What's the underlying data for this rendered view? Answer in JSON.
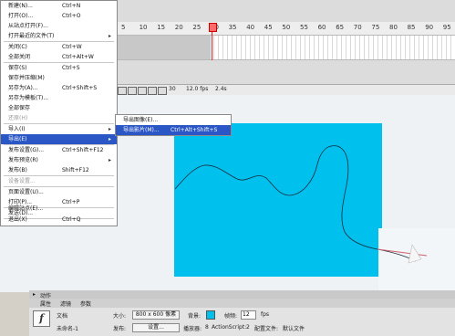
{
  "menu": {
    "items": [
      {
        "label": "新建(N)...",
        "shortcut": "Ctrl+N",
        "disabled": false,
        "submenu": false
      },
      {
        "label": "打开(O)...",
        "shortcut": "Ctrl+O",
        "disabled": false,
        "submenu": false
      },
      {
        "label": "从站点打开(F)...",
        "shortcut": "",
        "disabled": false,
        "submenu": false
      },
      {
        "label": "打开最近的文件(T)",
        "shortcut": "",
        "disabled": false,
        "submenu": true
      },
      {
        "label": "关闭(C)",
        "shortcut": "Ctrl+W",
        "disabled": false,
        "submenu": false
      },
      {
        "label": "全部关闭",
        "shortcut": "Ctrl+Alt+W",
        "disabled": false,
        "submenu": false
      },
      {
        "label": "保存(S)",
        "shortcut": "Ctrl+S",
        "disabled": false,
        "submenu": false
      },
      {
        "label": "保存并压缩(M)",
        "shortcut": "",
        "disabled": false,
        "submenu": false
      },
      {
        "label": "另存为(A)...",
        "shortcut": "Ctrl+Shift+S",
        "disabled": false,
        "submenu": false
      },
      {
        "label": "另存为模板(T)...",
        "shortcut": "",
        "disabled": false,
        "submenu": false
      },
      {
        "label": "全部保存",
        "shortcut": "",
        "disabled": false,
        "submenu": false
      },
      {
        "label": "还原(H)",
        "shortcut": "",
        "disabled": true,
        "submenu": false
      },
      {
        "label": "导入(I)",
        "shortcut": "",
        "disabled": false,
        "submenu": true
      },
      {
        "label": "导出(E)",
        "shortcut": "",
        "disabled": false,
        "submenu": true,
        "highlighted": true
      },
      {
        "label": "发布设置(G)...",
        "shortcut": "Ctrl+Shift+F12",
        "disabled": false,
        "submenu": false
      },
      {
        "label": "发布预览(R)",
        "shortcut": "",
        "disabled": false,
        "submenu": true
      },
      {
        "label": "发布(B)",
        "shortcut": "Shift+F12",
        "disabled": false,
        "submenu": false
      },
      {
        "label": "设备设置...",
        "shortcut": "",
        "disabled": true,
        "submenu": false
      },
      {
        "label": "页面设置(U)...",
        "shortcut": "",
        "disabled": false,
        "submenu": false
      },
      {
        "label": "打印(P)...",
        "shortcut": "Ctrl+P",
        "disabled": false,
        "submenu": false
      },
      {
        "label": "发送(D)...",
        "shortcut": "",
        "disabled": false,
        "submenu": false
      },
      {
        "label": "编辑站点(E)...",
        "shortcut": "",
        "disabled": false,
        "submenu": false
      },
      {
        "label": "退出(X)",
        "shortcut": "Ctrl+Q",
        "disabled": false,
        "submenu": false
      }
    ]
  },
  "submenu": {
    "items": [
      {
        "label": "导出图像(E)...",
        "shortcut": ""
      },
      {
        "label": "导出影片(M)...",
        "shortcut": "Ctrl+Alt+Shift+S",
        "highlighted": true
      }
    ]
  },
  "timeline": {
    "ticks": [
      "5",
      "10",
      "15",
      "20",
      "25",
      "30",
      "35",
      "40",
      "45",
      "50",
      "55",
      "60",
      "65",
      "70",
      "75",
      "80",
      "85",
      "90",
      "95"
    ],
    "current_frame": "30",
    "fps": "12.0 fps",
    "time": "2.4s"
  },
  "panel": {
    "section_label": "动作",
    "tabs": [
      "属性",
      "滤镜",
      "参数"
    ],
    "doc_label": "文档",
    "doc_name": "未命名-1",
    "size_label": "大小:",
    "size_value": "800 x 600 像素",
    "bg_label": "背景:",
    "fps_label": "帧频:",
    "fps_value": "12",
    "fps_unit": "fps",
    "publish_label": "发布:",
    "settings_button": "设置...",
    "player_label": "播放器:",
    "player_value": "8",
    "as_label": "ActionScript:",
    "as_value": "2",
    "profile_label": "配置文件:",
    "profile_value": "默认文件"
  },
  "colors": {
    "stage": "#00c1ee",
    "menu_highlight": "#2a57c5",
    "playhead": "#e02020",
    "bg_swatch": "#00c1ee"
  }
}
